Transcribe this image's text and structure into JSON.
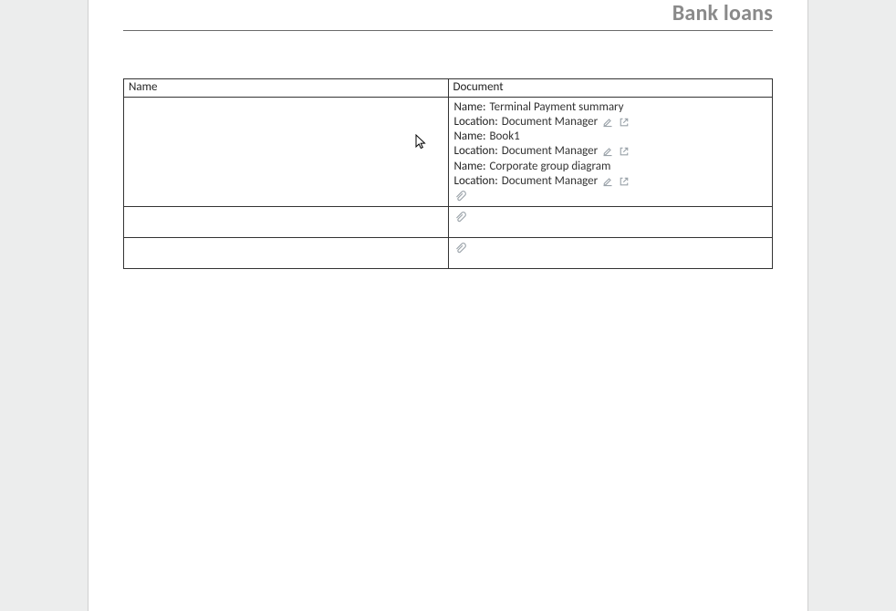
{
  "header": {
    "title": "Bank loans"
  },
  "table": {
    "columns": {
      "name": "Name",
      "document": "Document"
    },
    "label_name": "Name:",
    "label_location": "Location:",
    "location_value": "Document Manager",
    "rows": [
      {
        "name_value": "",
        "docs": [
          {
            "name": "Terminal Payment summary"
          },
          {
            "name": "Book1"
          },
          {
            "name": "Corporate group diagram"
          }
        ],
        "has_trailing_attach": true
      },
      {
        "name_value": "",
        "docs": [],
        "has_trailing_attach": true
      },
      {
        "name_value": "",
        "docs": [],
        "has_trailing_attach": true
      }
    ]
  },
  "icons": {
    "edit": "edit-icon",
    "open": "open-external-icon",
    "attach": "paperclip-icon"
  }
}
